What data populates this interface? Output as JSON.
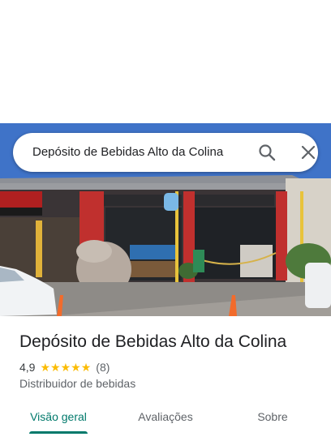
{
  "search": {
    "query": "Depósito de Bebidas Alto da Colina"
  },
  "place": {
    "name": "Depósito de Bebidas Alto da Colina",
    "rating": "4,9",
    "rating_stars": 5,
    "review_count": "(8)",
    "category": "Distribuidor de bebidas"
  },
  "tabs": [
    {
      "label": "Visão geral",
      "active": true
    },
    {
      "label": "Avaliações",
      "active": false
    },
    {
      "label": "Sobre",
      "active": false
    }
  ],
  "icons": {
    "search": "search-icon",
    "close": "close-icon",
    "star": "star-icon"
  },
  "colors": {
    "accent": "#00796b",
    "star": "#fbbc04",
    "text_primary": "#202124",
    "text_secondary": "#5f6368"
  }
}
